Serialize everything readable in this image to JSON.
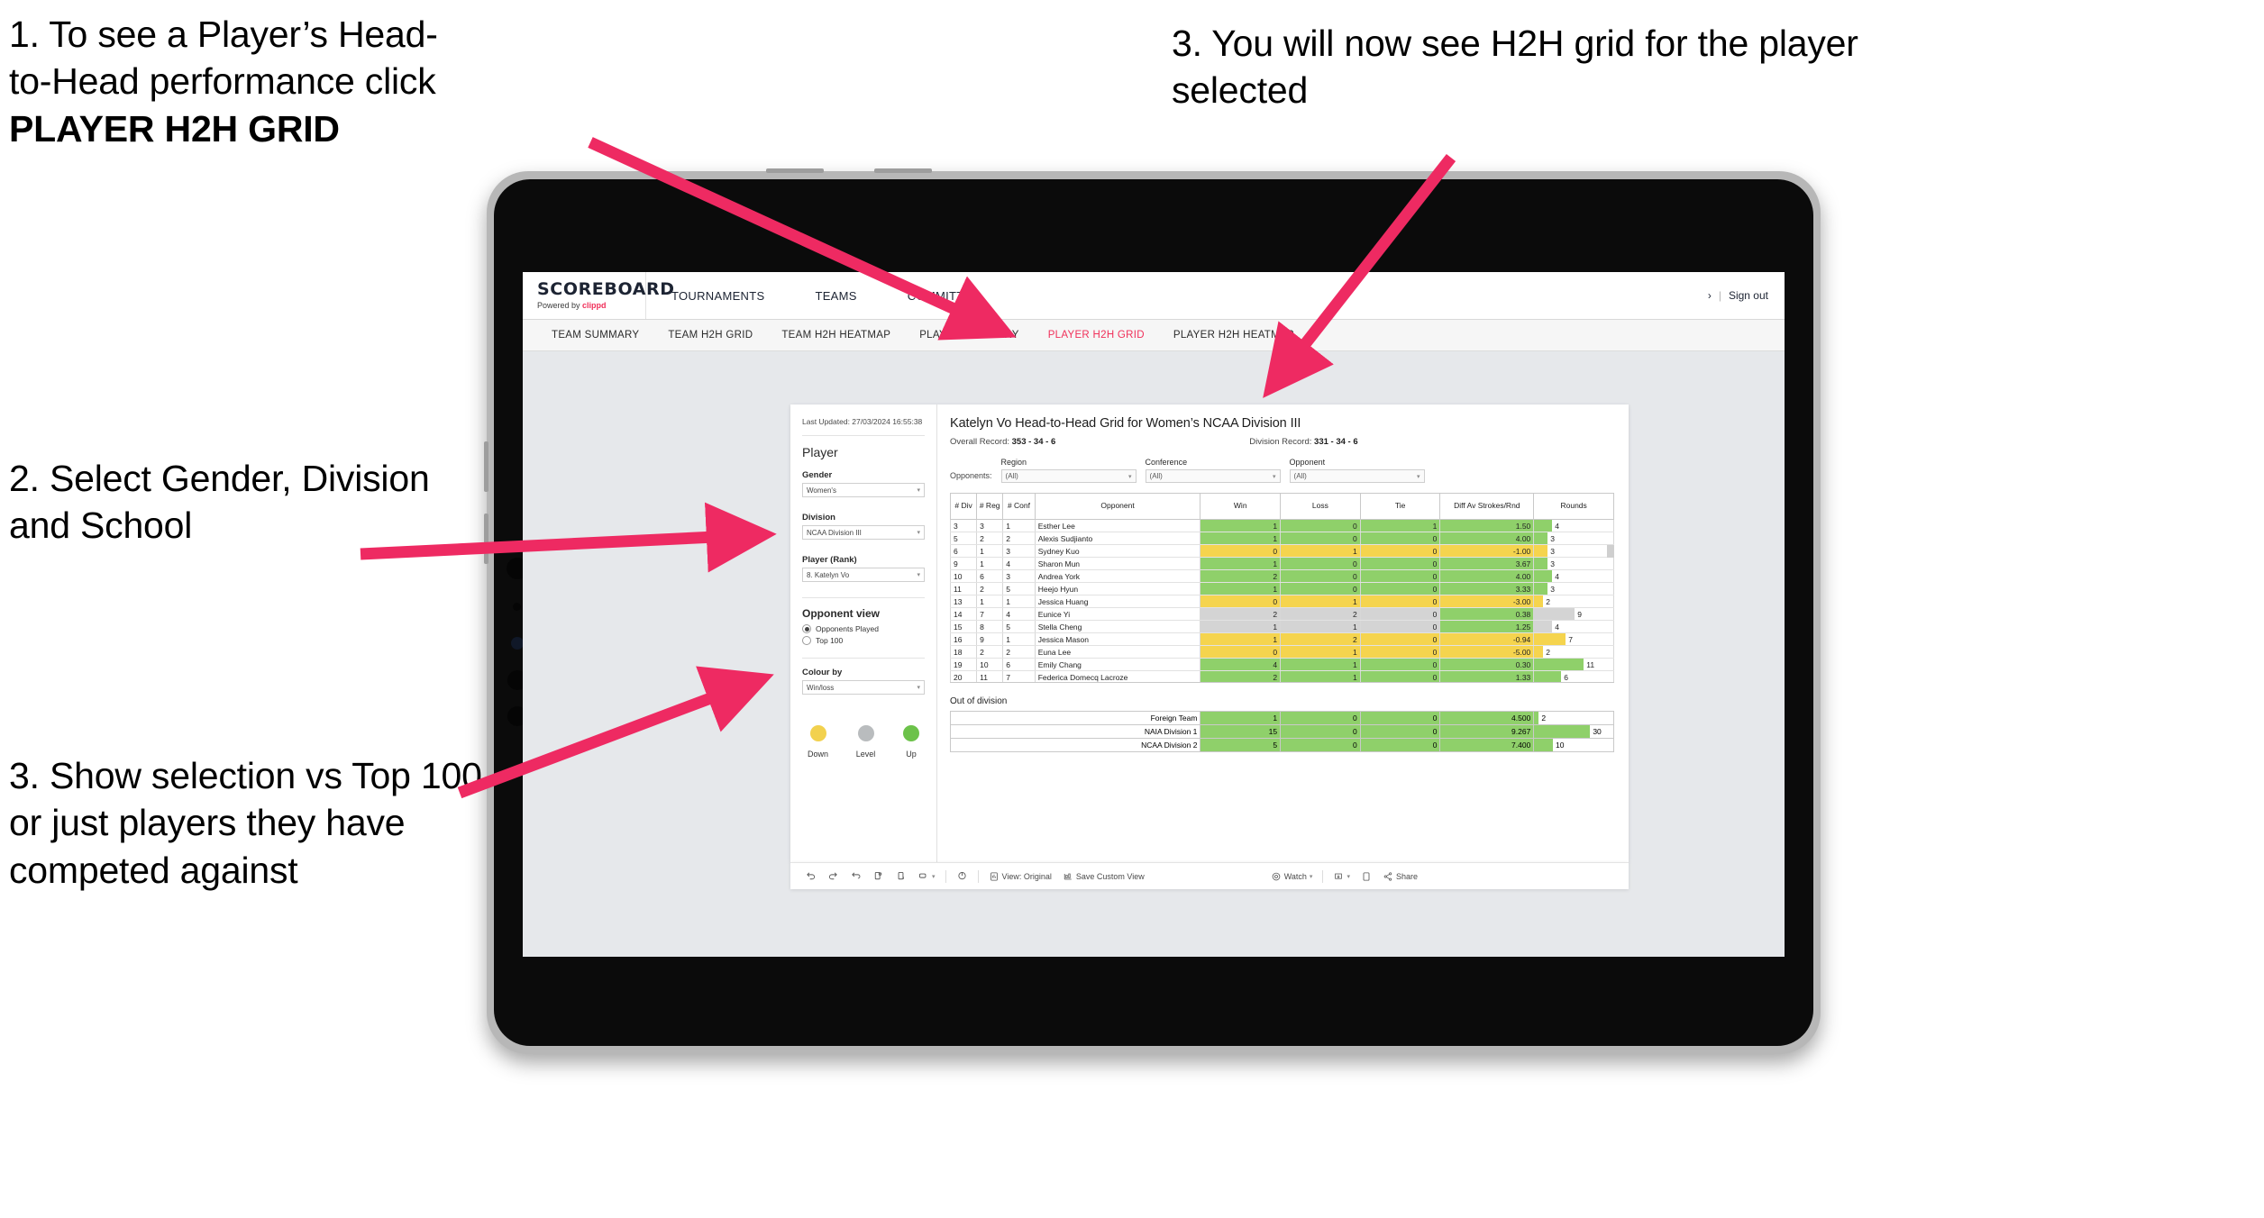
{
  "annotations": [
    {
      "id": "a1",
      "lines": [
        "1. To see a Player’s Head-",
        "to-Head performance click"
      ],
      "strong": "PLAYER H2H GRID"
    },
    {
      "id": "a2",
      "text": "2. Select Gender, Division and School"
    },
    {
      "id": "a3",
      "text": "3. Show selection vs Top 100 or just players they have competed against"
    },
    {
      "id": "a4",
      "text": "3. You will now see H2H grid for the player selected"
    }
  ],
  "accent": "#f0305a",
  "app": {
    "brand": {
      "title": "SCOREBOARD",
      "powered_prefix": "Powered by ",
      "powered_name": "clippd"
    },
    "topnav": [
      "TOURNAMENTS",
      "TEAMS",
      "COMMITTEE"
    ],
    "topbar_right": {
      "chevron": "›",
      "separator": "|",
      "signout": "Sign out"
    },
    "subnav": [
      {
        "label": "TEAM SUMMARY",
        "active": false
      },
      {
        "label": "TEAM H2H GRID",
        "active": false
      },
      {
        "label": "TEAM H2H HEATMAP",
        "active": false
      },
      {
        "label": "PLAYER SUMMARY",
        "active": false
      },
      {
        "label": "PLAYER H2H GRID",
        "active": true
      },
      {
        "label": "PLAYER H2H HEATMAP",
        "active": false
      }
    ]
  },
  "sidebar": {
    "last_updated": "Last Updated: 27/03/2024 16:55:38",
    "player_heading": "Player",
    "fields": [
      {
        "label": "Gender",
        "value": "Women's"
      },
      {
        "label": "Division",
        "value": "NCAA Division III"
      },
      {
        "label": "Player (Rank)",
        "value": "8. Katelyn Vo"
      }
    ],
    "opponent_view": {
      "heading": "Opponent view",
      "options": [
        {
          "label": "Opponents Played",
          "selected": true
        },
        {
          "label": "Top 100",
          "selected": false
        }
      ]
    },
    "colour_by": {
      "label": "Colour by",
      "value": "Win/loss"
    },
    "legend": [
      {
        "label": "Down",
        "color": "#f2d14e"
      },
      {
        "label": "Level",
        "color": "#b9bcbe"
      },
      {
        "label": "Up",
        "color": "#6cc24a"
      }
    ]
  },
  "main": {
    "title": "Katelyn Vo Head-to-Head Grid for Women’s NCAA Division III",
    "overall_label": "Overall Record: ",
    "overall_value": "353 -  34 - 6",
    "division_label": "Division Record: ",
    "division_value": "331 -  34 - 6",
    "opponents_label": "Opponents:",
    "filters": [
      {
        "label": "Region",
        "value": "(All)"
      },
      {
        "label": "Conference",
        "value": "(All)"
      },
      {
        "label": "Opponent",
        "value": "(All)"
      }
    ],
    "columns": [
      "# Div",
      "# Reg",
      "# Conf",
      "Opponent",
      "Win",
      "Loss",
      "Tie",
      "Diff Av Strokes/Rnd",
      "Rounds"
    ],
    "rows": [
      {
        "div": "3",
        "reg": "3",
        "conf": "1",
        "opponent": "Esther Lee",
        "win": "1",
        "loss": "0",
        "tie": "1",
        "diff": "1.50",
        "rounds": "4",
        "state": "win"
      },
      {
        "div": "5",
        "reg": "2",
        "conf": "2",
        "opponent": "Alexis Sudjianto",
        "win": "1",
        "loss": "0",
        "tie": "0",
        "diff": "4.00",
        "rounds": "3",
        "state": "win"
      },
      {
        "div": "6",
        "reg": "1",
        "conf": "3",
        "opponent": "Sydney Kuo",
        "win": "0",
        "loss": "1",
        "tie": "0",
        "diff": "-1.00",
        "rounds": "3",
        "state": "loss"
      },
      {
        "div": "9",
        "reg": "1",
        "conf": "4",
        "opponent": "Sharon Mun",
        "win": "1",
        "loss": "0",
        "tie": "0",
        "diff": "3.67",
        "rounds": "3",
        "state": "win"
      },
      {
        "div": "10",
        "reg": "6",
        "conf": "3",
        "opponent": "Andrea York",
        "win": "2",
        "loss": "0",
        "tie": "0",
        "diff": "4.00",
        "rounds": "4",
        "state": "win"
      },
      {
        "div": "11",
        "reg": "2",
        "conf": "5",
        "opponent": "Heejo Hyun",
        "win": "1",
        "loss": "0",
        "tie": "0",
        "diff": "3.33",
        "rounds": "3",
        "state": "win"
      },
      {
        "div": "13",
        "reg": "1",
        "conf": "1",
        "opponent": "Jessica Huang",
        "win": "0",
        "loss": "1",
        "tie": "0",
        "diff": "-3.00",
        "rounds": "2",
        "state": "loss"
      },
      {
        "div": "14",
        "reg": "7",
        "conf": "4",
        "opponent": "Eunice Yi",
        "win": "2",
        "loss": "2",
        "tie": "0",
        "diff": "0.38",
        "rounds": "9",
        "state": "tie"
      },
      {
        "div": "15",
        "reg": "8",
        "conf": "5",
        "opponent": "Stella Cheng",
        "win": "1",
        "loss": "1",
        "tie": "0",
        "diff": "1.25",
        "rounds": "4",
        "state": "tie"
      },
      {
        "div": "16",
        "reg": "9",
        "conf": "1",
        "opponent": "Jessica Mason",
        "win": "1",
        "loss": "2",
        "tie": "0",
        "diff": "-0.94",
        "rounds": "7",
        "state": "loss"
      },
      {
        "div": "18",
        "reg": "2",
        "conf": "2",
        "opponent": "Euna Lee",
        "win": "0",
        "loss": "1",
        "tie": "0",
        "diff": "-5.00",
        "rounds": "2",
        "state": "loss"
      },
      {
        "div": "19",
        "reg": "10",
        "conf": "6",
        "opponent": "Emily Chang",
        "win": "4",
        "loss": "1",
        "tie": "0",
        "diff": "0.30",
        "rounds": "11",
        "state": "win"
      },
      {
        "div": "20",
        "reg": "11",
        "conf": "7",
        "opponent": "Federica Domecq Lacroze",
        "win": "2",
        "loss": "1",
        "tie": "0",
        "diff": "1.33",
        "rounds": "6",
        "state": "win"
      }
    ],
    "out_of_division": {
      "title": "Out of division",
      "rows": [
        {
          "name": "Foreign Team",
          "win": "1",
          "loss": "0",
          "tie": "0",
          "diff": "4.500",
          "rounds": "2",
          "state": "win"
        },
        {
          "name": "NAIA Division 1",
          "win": "15",
          "loss": "0",
          "tie": "0",
          "diff": "9.267",
          "rounds": "30",
          "state": "win"
        },
        {
          "name": "NCAA Division 2",
          "win": "5",
          "loss": "0",
          "tie": "0",
          "diff": "7.400",
          "rounds": "10",
          "state": "win"
        }
      ]
    }
  },
  "toolbar": {
    "view_label": "View: Original",
    "save_label": "Save Custom View",
    "watch_label": "Watch",
    "share_label": "Share",
    "caret": "▾"
  },
  "chart_data": {
    "type": "table",
    "title": "Katelyn Vo Head-to-Head Grid for Women’s NCAA Division III",
    "columns": [
      "# Div",
      "# Reg",
      "# Conf",
      "Opponent",
      "Win",
      "Loss",
      "Tie",
      "Diff Av Strokes/Rnd",
      "Rounds"
    ],
    "rows": [
      [
        "3",
        "3",
        "1",
        "Esther Lee",
        1,
        0,
        1,
        1.5,
        4
      ],
      [
        "5",
        "2",
        "2",
        "Alexis Sudjianto",
        1,
        0,
        0,
        4.0,
        3
      ],
      [
        "6",
        "1",
        "3",
        "Sydney Kuo",
        0,
        1,
        0,
        -1.0,
        3
      ],
      [
        "9",
        "1",
        "4",
        "Sharon Mun",
        1,
        0,
        0,
        3.67,
        3
      ],
      [
        "10",
        "6",
        "3",
        "Andrea York",
        2,
        0,
        0,
        4.0,
        4
      ],
      [
        "11",
        "2",
        "5",
        "Heejo Hyun",
        1,
        0,
        0,
        3.33,
        3
      ],
      [
        "13",
        "1",
        "1",
        "Jessica Huang",
        0,
        1,
        0,
        -3.0,
        2
      ],
      [
        "14",
        "7",
        "4",
        "Eunice Yi",
        2,
        2,
        0,
        0.38,
        9
      ],
      [
        "15",
        "8",
        "5",
        "Stella Cheng",
        1,
        1,
        0,
        1.25,
        4
      ],
      [
        "16",
        "9",
        "1",
        "Jessica Mason",
        1,
        2,
        0,
        -0.94,
        7
      ],
      [
        "18",
        "2",
        "2",
        "Euna Lee",
        0,
        1,
        0,
        -5.0,
        2
      ],
      [
        "19",
        "10",
        "6",
        "Emily Chang",
        4,
        1,
        0,
        0.3,
        11
      ],
      [
        "20",
        "11",
        "7",
        "Federica Domecq Lacroze",
        2,
        1,
        0,
        1.33,
        6
      ]
    ],
    "out_of_division_rows": [
      [
        "Foreign Team",
        1,
        0,
        0,
        4.5,
        2
      ],
      [
        "NAIA Division 1",
        15,
        0,
        0,
        9.267,
        30
      ],
      [
        "NCAA Division 2",
        5,
        0,
        0,
        7.4,
        10
      ]
    ],
    "colors": {
      "win": "#8fd06a",
      "loss": "#f5d44e",
      "tie": "#d4d4d4"
    },
    "rounds_max": 30
  }
}
